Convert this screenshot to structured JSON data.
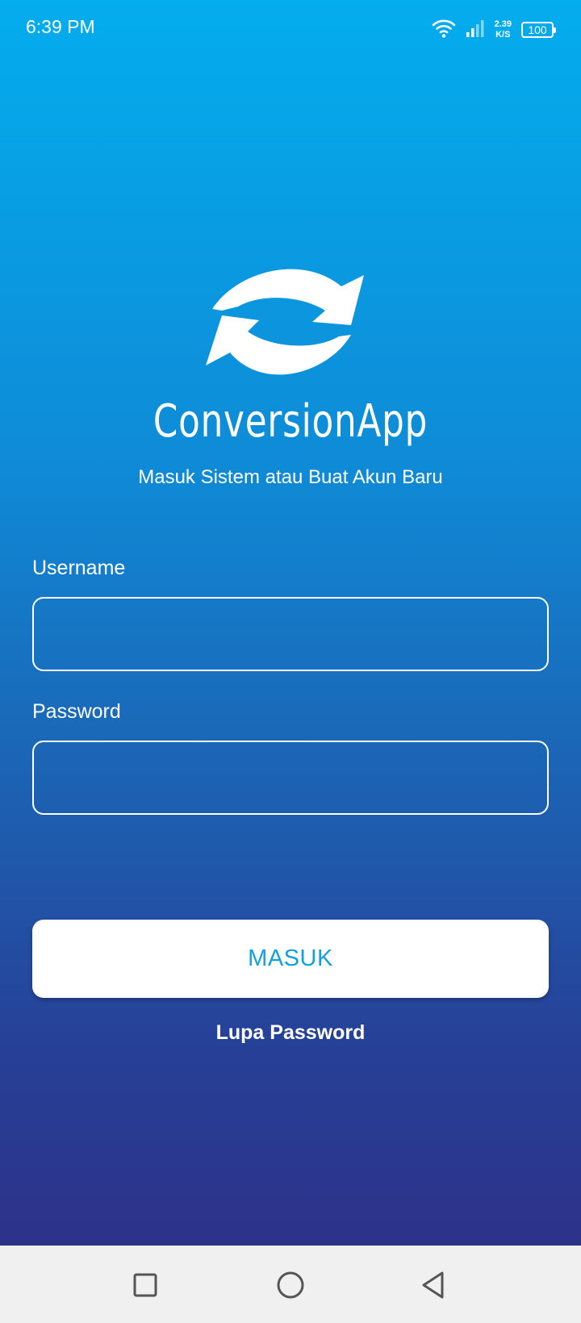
{
  "status_bar": {
    "time": "6:39 PM",
    "net_speed_value": "2.39",
    "net_speed_unit": "K/S",
    "battery": "100",
    "icons": [
      "wifi-icon",
      "signal-icon",
      "battery-icon"
    ]
  },
  "app": {
    "title": "ConversionApp",
    "subtitle": "Masuk Sistem atau Buat Akun Baru",
    "logo_icon": "sync-arrows-icon"
  },
  "form": {
    "username_label": "Username",
    "username_value": "",
    "password_label": "Password",
    "password_value": "",
    "submit_label": "MASUK",
    "forgot_label": "Lupa Password"
  },
  "nav_bar": {
    "icons": [
      "recents-square-icon",
      "home-circle-icon",
      "back-triangle-icon"
    ]
  },
  "colors": {
    "gradient_top": "#03ADEE",
    "gradient_bottom": "#2D3289",
    "button_text": "#11A1E0",
    "nav_bg": "#F0F0F0"
  }
}
